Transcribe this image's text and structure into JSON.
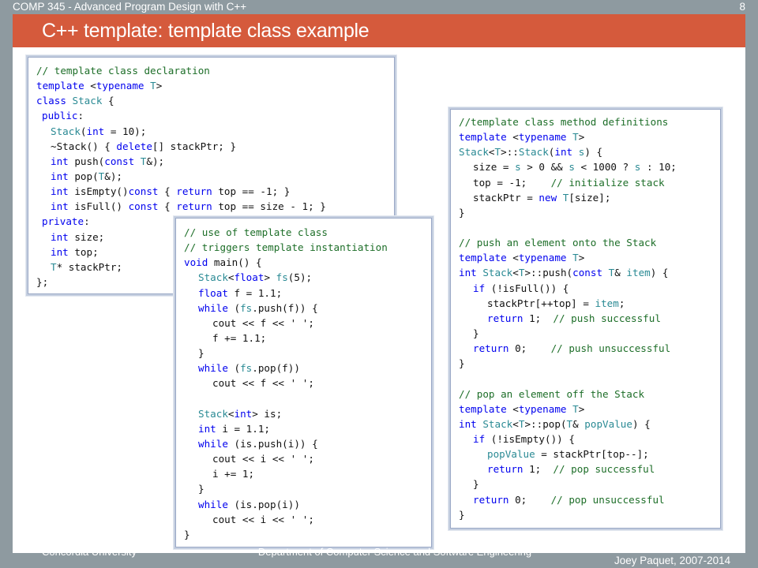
{
  "header": {
    "course": "COMP 345 - Advanced Program Design with C++",
    "slide_number": "8",
    "title": "C++ template: template class example"
  },
  "footer": {
    "left": "Concordia University",
    "middle": "Department of Computer Science and Software Engineering",
    "right": "Joey Paquet, 2007-2014"
  },
  "colors": {
    "title_bar": "#d55a3c",
    "frame": "#8e9aa0",
    "keyword": "#0000ee",
    "comment": "#1d6e28",
    "type": "#2a8a94"
  },
  "code_declaration": [
    "// template class declaration",
    "template <typename T>",
    "class Stack {",
    "public:",
    "Stack(int = 10);",
    "~Stack() { delete[] stackPtr; }",
    "int push(const T&);",
    "int pop(T&);",
    "int isEmpty()const { return top == -1; }",
    "int isFull() const { return top == size - 1; }",
    "private:",
    "int size;",
    "int top;",
    "T* stackPtr;",
    "};"
  ],
  "code_usage": [
    "// use of template class",
    "// triggers template instantiation",
    "void main() {",
    "Stack<float> fs(5);",
    "float f = 1.1;",
    "while (fs.push(f)) {",
    "cout << f << ' ';",
    "f += 1.1;",
    "}",
    "while (fs.pop(f))",
    "cout << f << ' ';",
    "",
    "Stack<int> is;",
    "int i = 1.1;",
    "while (is.push(i)) {",
    "cout << i << ' ';",
    "i += 1;",
    "}",
    "while (is.pop(i))",
    "cout << i << ' ';",
    "}"
  ],
  "code_definitions": [
    "//template class method definitions",
    "template <typename T>",
    "Stack<T>::Stack(int s) {",
    "size = s > 0 && s < 1000 ? s : 10;",
    "top = -1;    // initialize stack",
    "stackPtr = new T[size];",
    "}",
    "",
    "// push an element onto the Stack",
    "template <typename T>",
    "int Stack<T>::push(const T& item) {",
    "if (!isFull()) {",
    "stackPtr[++top] = item;",
    "return 1;  // push successful",
    "}",
    "return 0;    // push unsuccessful",
    "}",
    "",
    "// pop an element off the Stack",
    "template <typename T>",
    "int Stack<T>::pop(T& popValue) {",
    "if (!isEmpty()) {",
    "popValue = stackPtr[top--];",
    "return 1;  // pop successful",
    "}",
    "return 0;    // pop unsuccessful",
    "}"
  ]
}
